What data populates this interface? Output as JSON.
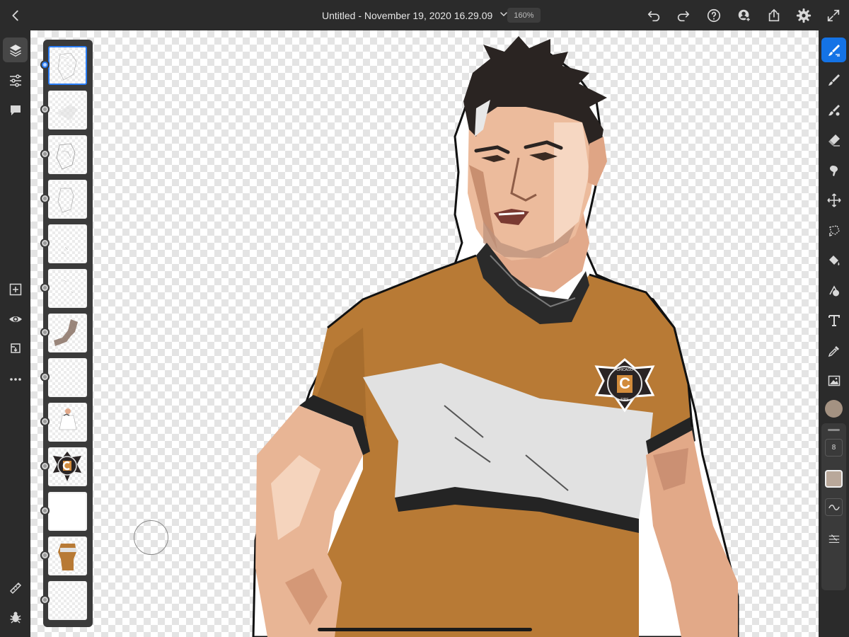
{
  "header": {
    "title": "Untitled - November 19, 2020 16.29.09",
    "zoom": "160%"
  },
  "icons": {
    "back": "chevron-left-icon",
    "undo": "undo-icon",
    "redo": "redo-icon",
    "help": "help-icon",
    "invite": "invite-user-icon",
    "share": "share-icon",
    "settings": "gear-icon",
    "fullscreen": "expand-icon"
  },
  "left_toolbar": {
    "items": [
      "layers-icon",
      "adjustments-icon",
      "comments-icon",
      "add-layer-icon",
      "visibility-icon",
      "layer-properties-icon",
      "more-icon",
      "ruler-icon",
      "bug-icon"
    ]
  },
  "layers": {
    "count": 13,
    "selected_index": 0,
    "items": [
      "sketch",
      "faint-shading",
      "outline",
      "outline",
      "light-lines",
      "light-lines",
      "brown-shading",
      "empty",
      "figure-white",
      "chicago-fire-crest",
      "blank-white",
      "figure-orange",
      "empty"
    ]
  },
  "right_toolbar": {
    "active_tool": "brush",
    "tools": [
      "pixel-brush-icon",
      "live-brush-icon",
      "mixer-brush-icon",
      "eraser-icon",
      "smudge-icon",
      "transform-icon",
      "lasso-icon",
      "fill-icon",
      "shape-icon",
      "text-icon",
      "eyedropper-icon",
      "image-icon"
    ],
    "brush_size": "8",
    "colors": {
      "current": "#a49282",
      "active_accent": "#1473e6"
    }
  },
  "artwork": {
    "crest_text_top": "CHICAGO",
    "crest_letter": "C",
    "crest_text_bottom": "FIRE",
    "colors": {
      "jersey": "#b87a35",
      "band": "#e1e1e1",
      "skin": "#e8b595",
      "hair": "#2a2422",
      "trim": "#242424"
    }
  }
}
